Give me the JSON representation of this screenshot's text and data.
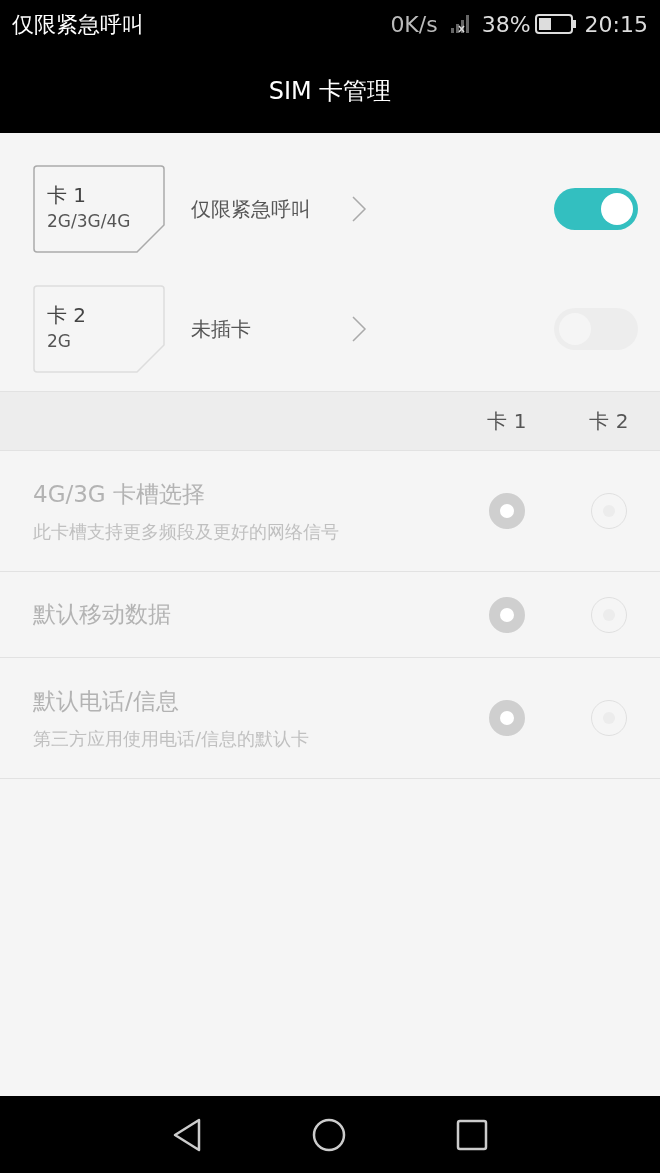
{
  "status_bar": {
    "carrier": "仅限紧急呼叫",
    "speed": "0K/s",
    "battery": "38%",
    "time": "20:15"
  },
  "title": "SIM 卡管理",
  "sims": [
    {
      "name": "卡 1",
      "networks": "2G/3G/4G",
      "status": "仅限紧急呼叫",
      "on": true,
      "disabled": false
    },
    {
      "name": "卡 2",
      "networks": "2G",
      "status": "未插卡",
      "on": false,
      "disabled": true
    }
  ],
  "columns": [
    "卡 1",
    "卡 2"
  ],
  "settings": [
    {
      "title": "4G/3G 卡槽选择",
      "subtitle": "此卡槽支持更多频段及更好的网络信号",
      "disabled": true,
      "options": [
        {
          "selected": true
        },
        {
          "selected": false
        }
      ]
    },
    {
      "title": "默认移动数据",
      "disabled": true,
      "options": [
        {
          "selected": true
        },
        {
          "selected": false
        }
      ]
    },
    {
      "title": "默认电话/信息",
      "subtitle": "第三方应用使用电话/信息的默认卡",
      "disabled": true,
      "options": [
        {
          "selected": true
        },
        {
          "selected": false
        }
      ]
    }
  ]
}
